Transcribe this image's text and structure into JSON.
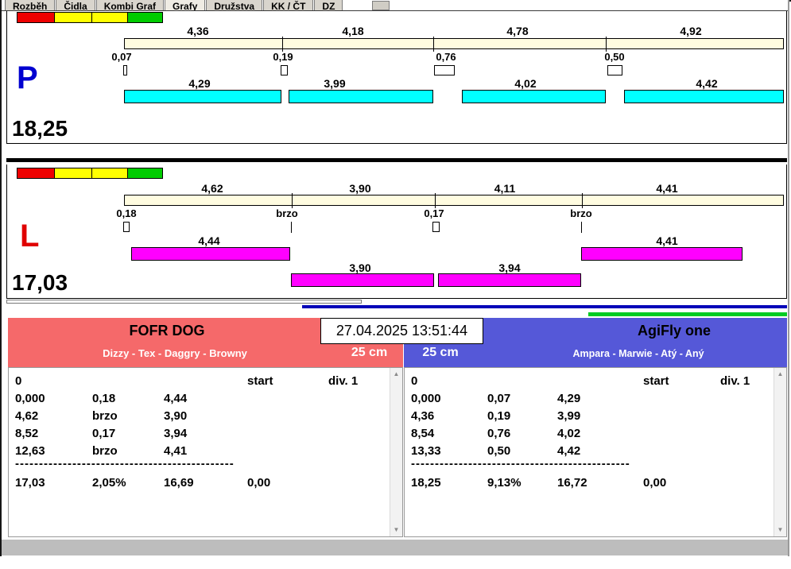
{
  "tabs": {
    "items": [
      {
        "label": "Rozběh"
      },
      {
        "label": "Čidla"
      },
      {
        "label": "Kombi Graf"
      },
      {
        "label": "Grafy"
      },
      {
        "label": "Družstva"
      },
      {
        "label": "KK / ČT"
      },
      {
        "label": "DZ"
      }
    ]
  },
  "colors": {
    "lane_p_letter": "#0000d0",
    "lane_l_letter": "#e00000",
    "split_bar": "#fffce0",
    "run_bar_p": "#00ffff",
    "run_bar_l": "#ff00ff",
    "legend": [
      "#ee0000",
      "#ffff00",
      "#ffff00",
      "#00cc00"
    ],
    "team_left_header": "#f5696a",
    "team_right_header": "#5558d8",
    "progress_blue": "#0000b8",
    "progress_green": "#00cc22"
  },
  "lane_p": {
    "letter": "P",
    "total": "18,25",
    "splits": [
      "4,36",
      "4,18",
      "4,78",
      "4,92"
    ],
    "reactions": [
      "0,07",
      "0,19",
      "0,76",
      "0,50"
    ],
    "runs": [
      "4,29",
      "3,99",
      "4,02",
      "4,42"
    ]
  },
  "lane_l": {
    "letter": "L",
    "total": "17,03",
    "splits": [
      "4,62",
      "3,90",
      "4,11",
      "4,41"
    ],
    "reactions": [
      "0,18",
      "brzo",
      "0,17",
      "brzo"
    ],
    "runs": [
      "4,44",
      "3,90",
      "3,94",
      "4,41"
    ]
  },
  "datetime": "27.04.2025 13:51:44",
  "team_left": {
    "name": "FOFR DOG",
    "dogs": "Dizzy - Tex - Daggry - Browny",
    "category": "25 cm",
    "header_zero": "0",
    "header_start": "start",
    "header_div": "div. 1",
    "rows": [
      [
        "0,000",
        "0,18",
        "4,44"
      ],
      [
        "4,62",
        "brzo",
        "3,90"
      ],
      [
        "8,52",
        "0,17",
        "3,94"
      ],
      [
        "12,63",
        "brzo",
        "4,41"
      ]
    ],
    "divider": "----------------------------------------------",
    "summary": [
      "17,03",
      "2,05%",
      "16,69",
      "0,00"
    ]
  },
  "team_right": {
    "name": "AgiFly one",
    "dogs": "Ampara - Marwie - Atý - Aný",
    "category": "25 cm",
    "header_zero": "0",
    "header_start": "start",
    "header_div": "div. 1",
    "rows": [
      [
        "0,000",
        "0,07",
        "4,29"
      ],
      [
        "4,36",
        "0,19",
        "3,99"
      ],
      [
        "8,54",
        "0,76",
        "4,02"
      ],
      [
        "13,33",
        "0,50",
        "4,42"
      ]
    ],
    "divider": "----------------------------------------------",
    "summary": [
      "18,25",
      "9,13%",
      "16,72",
      "0,00"
    ]
  }
}
